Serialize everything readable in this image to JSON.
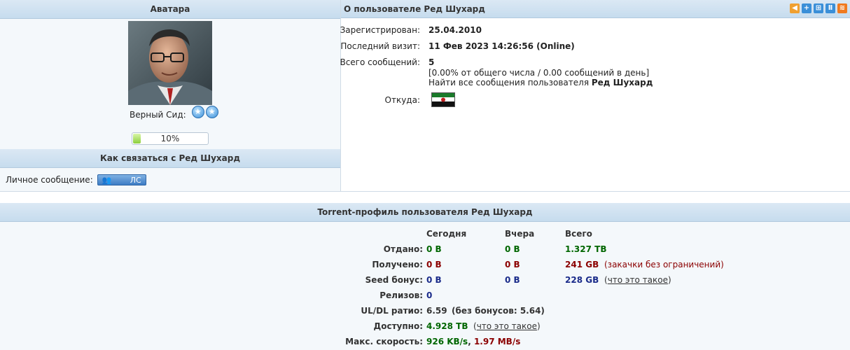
{
  "avatar_panel": {
    "header": "Аватара",
    "rank_label": "Верный Сид:",
    "progress_text": "10%",
    "progress_value": 0.1
  },
  "contact_panel": {
    "header": "Как связаться с Ред Шухард",
    "pm_label": "Личное сообщение:",
    "pm_button": "ЛС"
  },
  "user_panel": {
    "header": "О пользователе Ред Шухард",
    "registered_label": "Зарегистрирован:",
    "registered_value": "25.04.2010",
    "last_visit_label": "Последний визит:",
    "last_visit_value": "11 Фев 2023 14:26:56 (Online)",
    "posts_label": "Всего сообщений:",
    "posts_value": "5",
    "posts_stats": "[0.00% от общего числа / 0.00 сообщений в день]",
    "find_posts_prefix": "Найти все сообщения пользователя",
    "find_posts_user": "Ред Шухард",
    "location_label": "Откуда:",
    "toolbar_icons": [
      "rss-icon",
      "plus-icon",
      "grid-icon",
      "pause-icon",
      "feed-icon"
    ]
  },
  "torrent_panel": {
    "header": "Torrent-профиль пользователя Ред Шухард",
    "columns": [
      "Сегодня",
      "Вчера",
      "Всего"
    ],
    "rows": {
      "uploaded": {
        "label": "Отдано:",
        "today": "0 B",
        "yesterday": "0 B",
        "total": "1.327 TB"
      },
      "downloaded": {
        "label": "Получено:",
        "today": "0 B",
        "yesterday": "0 B",
        "total": "241 GB",
        "note": "(закачки без ограничений)"
      },
      "seed_bonus": {
        "label": "Seed бонус:",
        "today": "0 B",
        "yesterday": "0 B",
        "total": "228 GB",
        "note": "что это такое"
      },
      "releases": {
        "label": "Релизов:",
        "value": "0"
      },
      "ratio": {
        "label": "UL/DL ратио:",
        "value": "6.59",
        "extra": "(без бонусов: 5.64)"
      },
      "available": {
        "label": "Доступно:",
        "value": "4.928 TB",
        "note": "что это такое"
      },
      "max_speed": {
        "label": "Макс. скорость:",
        "value_up": "926 KB/s",
        "sep": ",",
        "value_down": "1.97 MB/s"
      }
    }
  },
  "colors": {
    "green": "#006600",
    "red": "#8b0000",
    "blue": "#1a2b8a"
  }
}
